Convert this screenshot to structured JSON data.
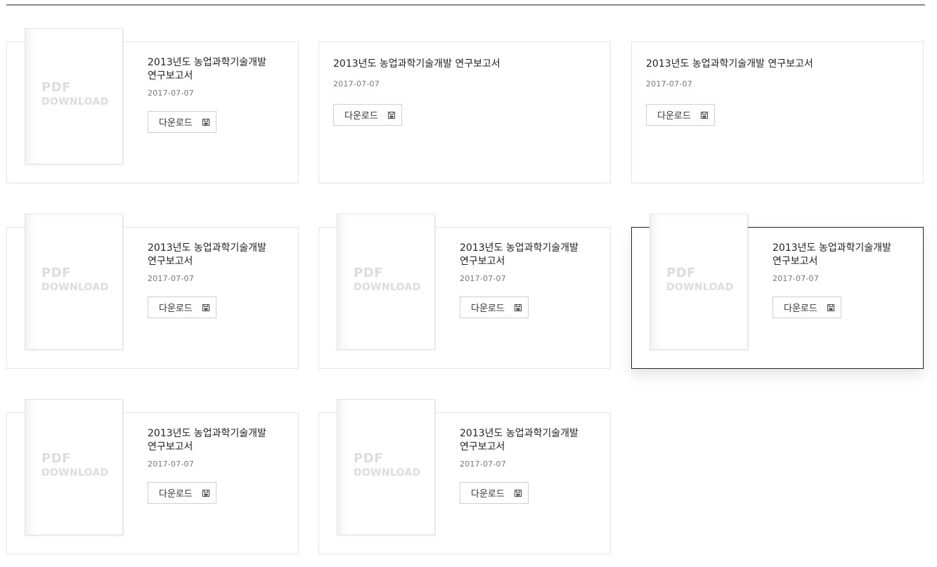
{
  "thumb_text": {
    "line1": "PDF",
    "line2": "DOWNLOAD"
  },
  "cards": [
    {
      "title": "2013년도 농업과학기술개발 연구보고서",
      "date": "2017-07-07",
      "button": "다운로드",
      "icon": "save-icon"
    },
    {
      "title": "2013년도 농업과학기술개발 연구보고서",
      "date": "2017-07-07",
      "button": "다운로드",
      "icon": "save-icon"
    },
    {
      "title": "2013년도 농업과학기술개발 연구보고서",
      "date": "2017-07-07",
      "button": "다운로드",
      "icon": "save-icon"
    },
    {
      "title": "2013년도 농업과학기술개발 연구보고서",
      "date": "2017-07-07",
      "button": "다운로드",
      "icon": "save-icon"
    },
    {
      "title": "2013년도 농업과학기술개발 연구보고서",
      "date": "2017-07-07",
      "button": "다운로드",
      "icon": "save-icon"
    },
    {
      "title": "2013년도 농업과학기술개발 연구보고서",
      "date": "2017-07-07",
      "button": "다운로드",
      "icon": "save-icon"
    },
    {
      "title": "2013년도 농업과학기술개발 연구보고서",
      "date": "2017-07-07",
      "button": "다운로드",
      "icon": "save-icon"
    },
    {
      "title": "2013년도 농업과학기술개발 연구보고서",
      "date": "2017-07-07",
      "button": "다운로드",
      "icon": "save-icon"
    }
  ],
  "colors": {
    "border": "#e4e4e4",
    "hover_border": "#222222",
    "thumb_text": "#dcdcdc",
    "top_rule": "#8a8a8a"
  }
}
